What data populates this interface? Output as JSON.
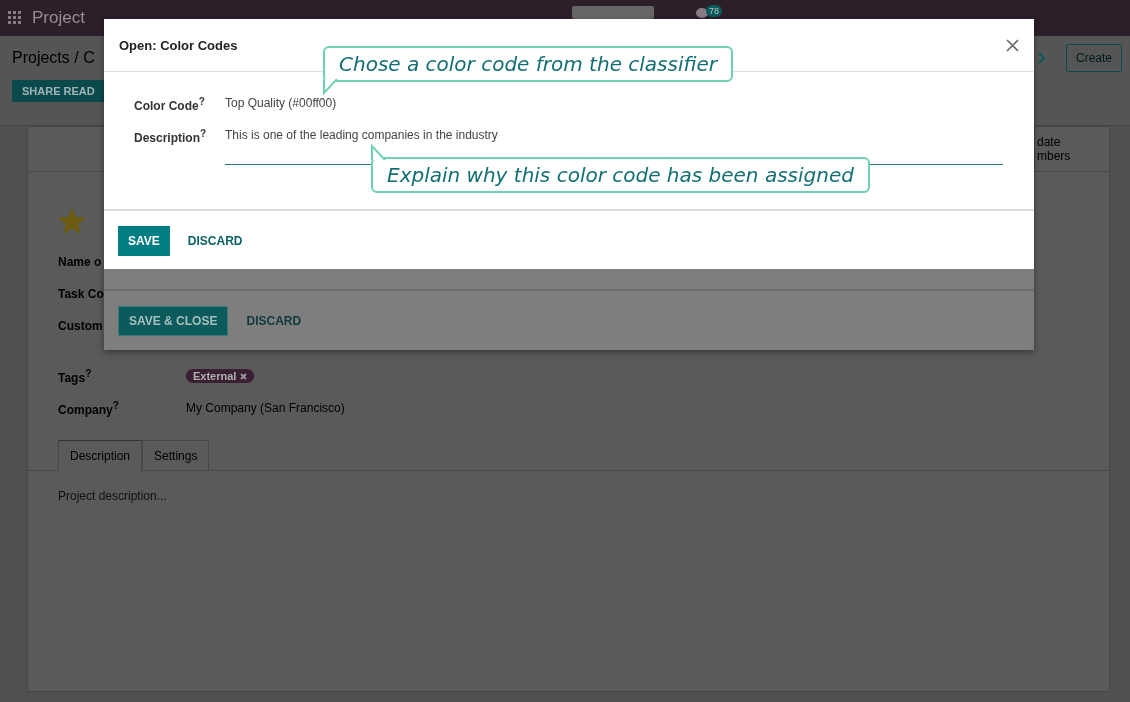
{
  "navbar": {
    "app_name": "Project",
    "message_count": "78"
  },
  "breadcrumb": "Projects / C",
  "share_button": "SHARE READ",
  "create_button": "Create",
  "smart_button": {
    "lines": [
      "date",
      "mbers"
    ]
  },
  "form": {
    "starred": true,
    "fields": [
      {
        "label": "Name o"
      },
      {
        "label": "Task Co"
      },
      {
        "label": "Custom"
      }
    ],
    "tags_label": "Tags$^{?}$",
    "tags": [
      {
        "text": "External",
        "color": "#3b1f33"
      }
    ],
    "company_label": "Company$^{?}$",
    "company_value": "My Company (San Francisco)",
    "tabs": [
      {
        "label": "Description",
        "selected": true
      },
      {
        "label": "Settings",
        "selected": false
      }
    ],
    "description_placeholder": "Project description..."
  },
  "parent_dialog": {
    "buttons": [
      {
        "label": "SAVE & CLOSE",
        "kind": "primary"
      },
      {
        "label": "DISCARD",
        "kind": "link"
      }
    ]
  },
  "dialog": {
    "title": "Open: Color Codes",
    "fields": [
      {
        "label": "Color Code$^{?}$",
        "value": "Top Quality (#00ff00)"
      },
      {
        "label": "Description$^{?}$",
        "value": "This is one of the leading companies in the industry"
      }
    ],
    "buttons": [
      {
        "label": "SAVE",
        "kind": "primary"
      },
      {
        "label": "DISCARD",
        "kind": "link"
      }
    ]
  },
  "callouts": [
    {
      "text": "Chose a color code from the classifier",
      "kind": "down"
    },
    {
      "text": "Explain why this color code has been assigned",
      "kind": "up"
    }
  ]
}
